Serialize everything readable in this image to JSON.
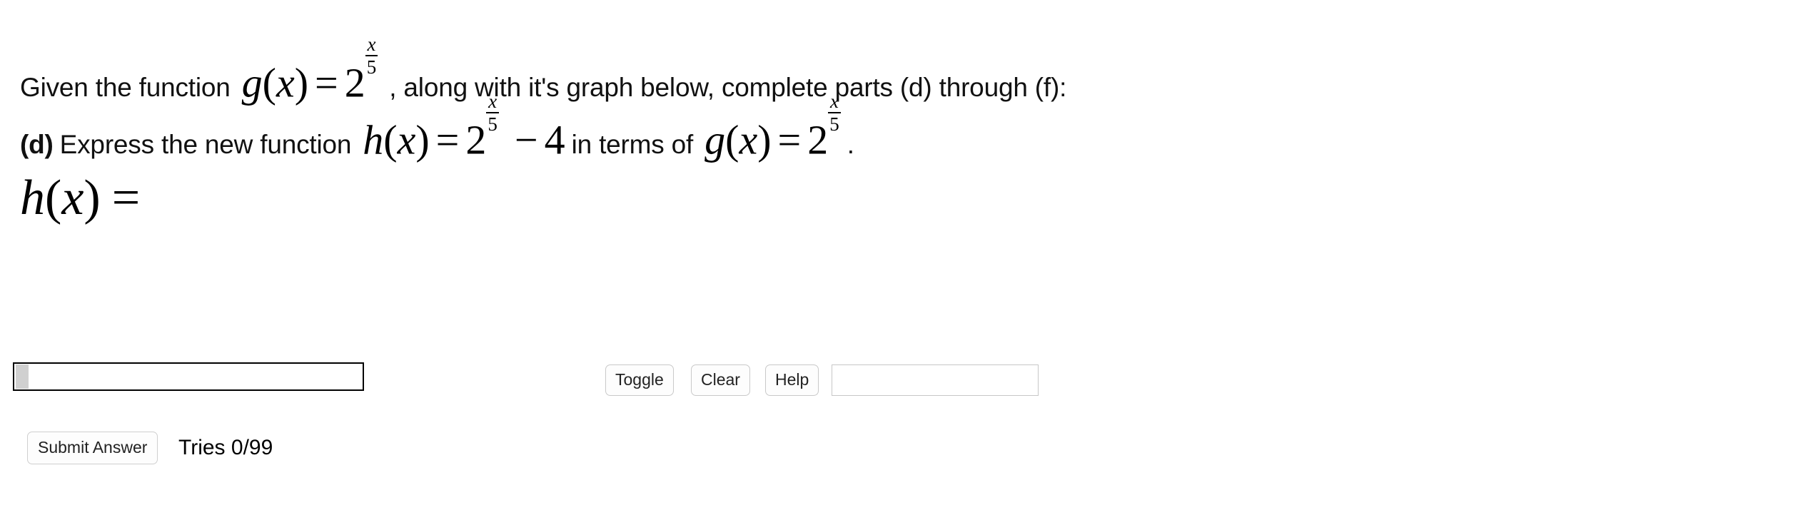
{
  "question": {
    "intro_prefix": "Given the function",
    "intro_suffix": ", along with it's graph below, complete parts (d) through (f):",
    "part_label": "(d)",
    "part_prefix": "Express the new function",
    "part_middle": "in terms of",
    "part_period": ".",
    "answer_prompt_base": "h",
    "answer_prompt_var": "x",
    "answer_prompt_equals": "="
  },
  "math": {
    "g_base": "g",
    "h_base": "h",
    "variable": "x",
    "paren_open": "(",
    "paren_close": ")",
    "equals": "=",
    "power_base": "2",
    "exponent_numerator": "x",
    "exponent_denominator": "5",
    "minus": "−",
    "shift_constant": "4"
  },
  "answer_input": {
    "value": "",
    "placeholder": "",
    "caret_visible": true
  },
  "preview": {
    "value": ""
  },
  "toolbar": {
    "toggle_label": "Toggle",
    "clear_label": "Clear",
    "help_label": "Help"
  },
  "submit": {
    "button_label": "Submit Answer",
    "tries_label": "Tries 0/99",
    "tries_used": 0,
    "tries_total": 99
  },
  "colors": {
    "background": "#ffffff",
    "text": "#000000",
    "input_border": "#000000",
    "caret_block": "#d0d0d0",
    "button_border": "#c9c9c9",
    "button_background": "#fdfdfd",
    "preview_border": "#c7c7c7"
  }
}
